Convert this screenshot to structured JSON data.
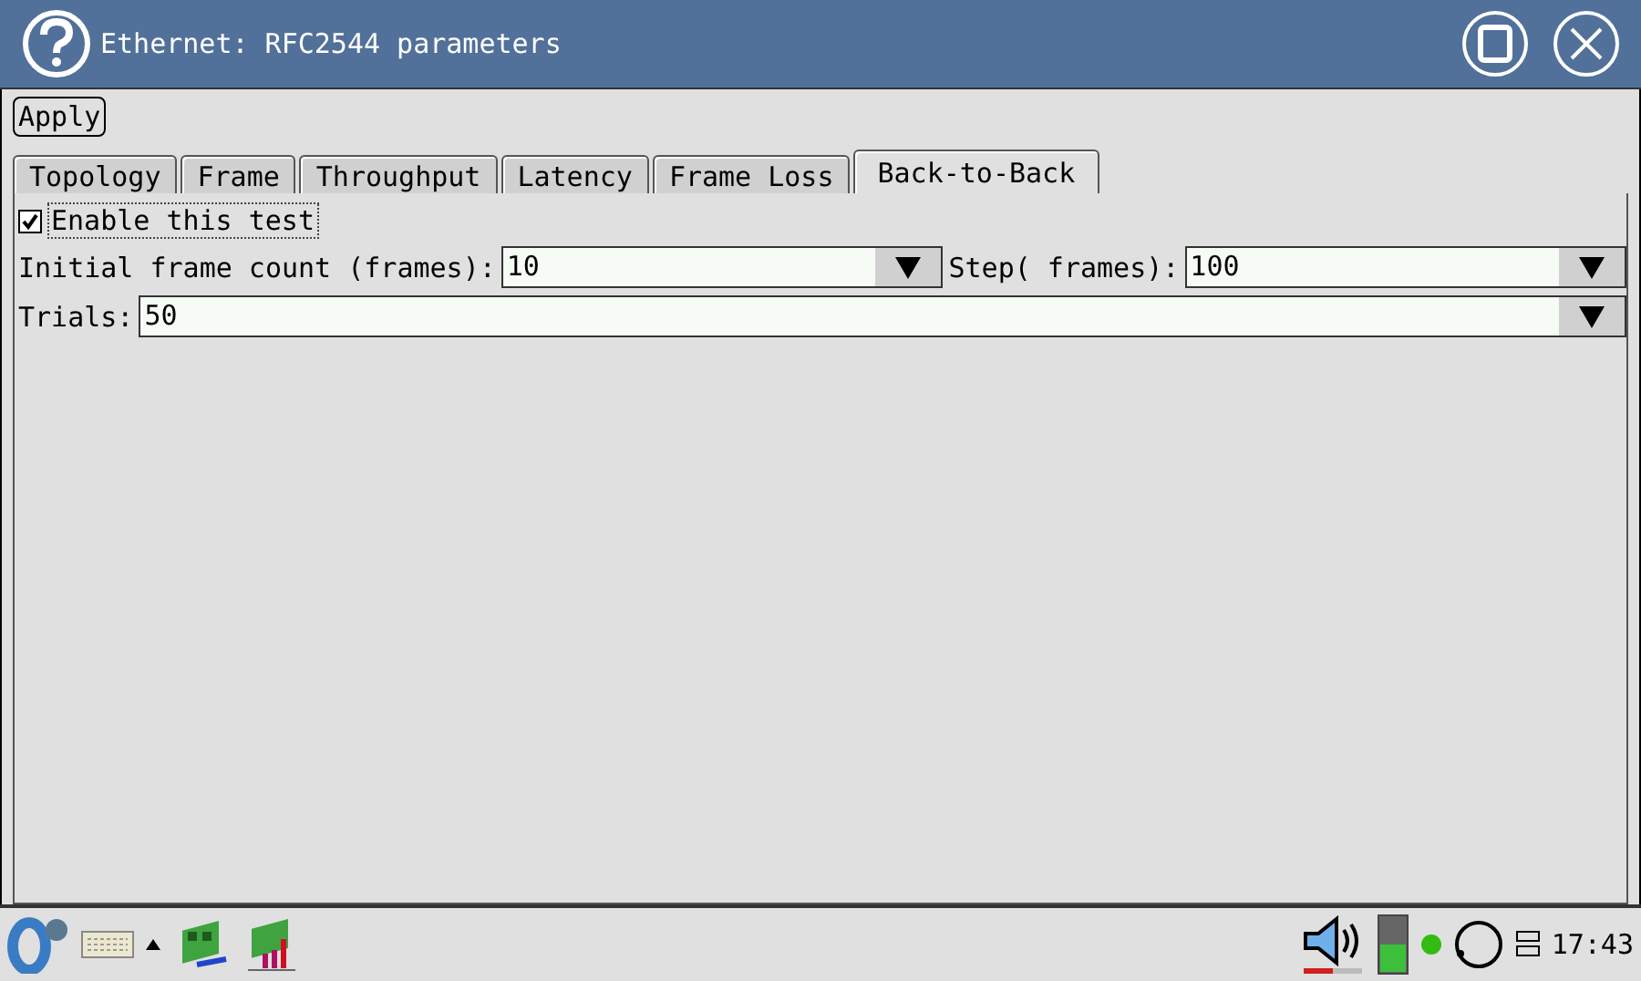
{
  "window": {
    "title": "Ethernet: RFC2544 parameters"
  },
  "toolbar": {
    "apply_button": "Apply"
  },
  "tabs": [
    {
      "label": "Topology",
      "selected": false
    },
    {
      "label": "Frame",
      "selected": false
    },
    {
      "label": "Throughput",
      "selected": false
    },
    {
      "label": "Latency",
      "selected": false
    },
    {
      "label": "Frame Loss",
      "selected": false
    },
    {
      "label": "Back-to-Back",
      "selected": true
    }
  ],
  "enable_test": {
    "label": "Enable this test",
    "checked": true
  },
  "fields": [
    {
      "label": "Initial frame count (frames):",
      "value": "10"
    },
    {
      "label": "Step( frames):",
      "value": "100"
    },
    {
      "label": "Trials:",
      "value": "50"
    }
  ],
  "taskbar": {
    "clock": "17:43"
  }
}
